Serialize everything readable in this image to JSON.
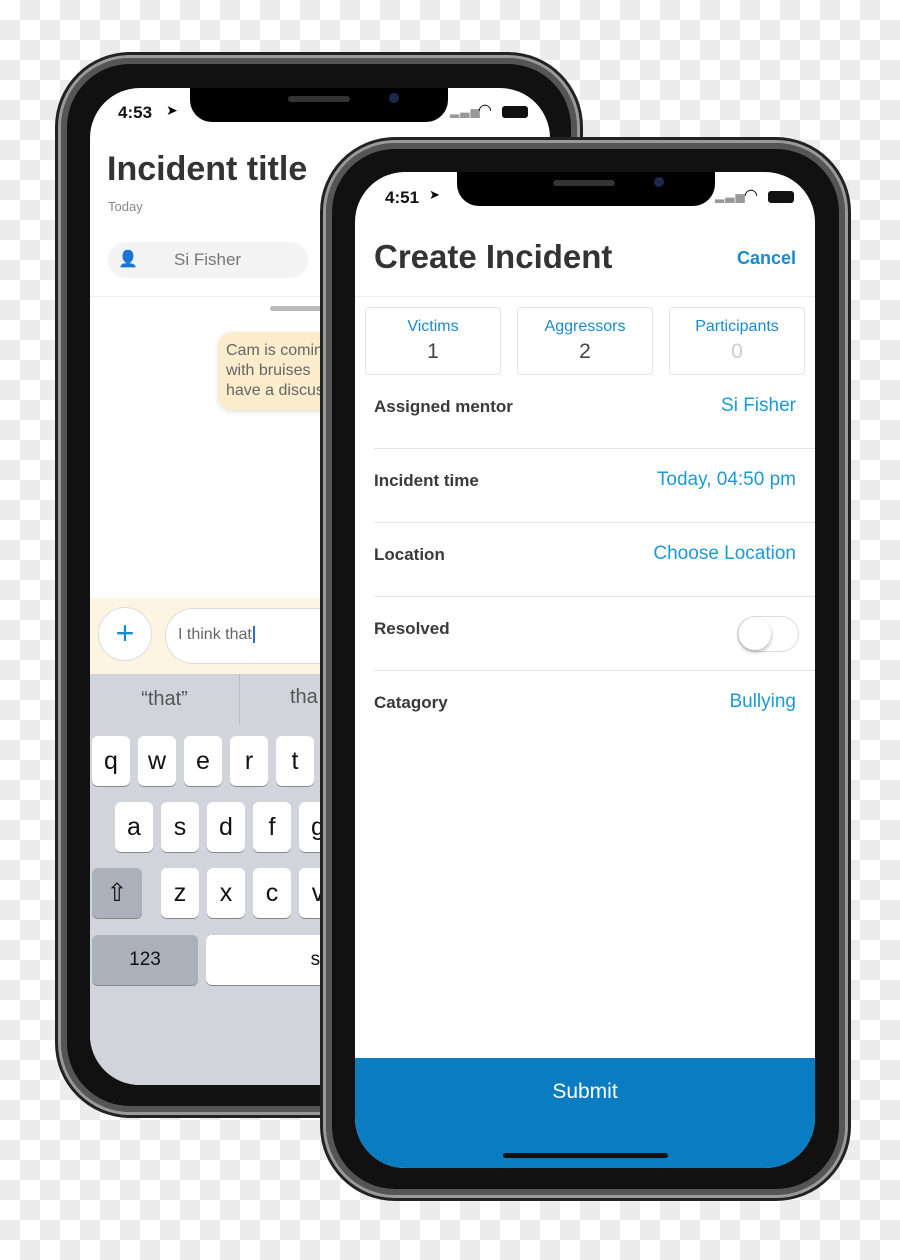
{
  "back_phone": {
    "status_time": "4:53",
    "title": "Incident title",
    "date": "Today",
    "assignee": "Si Fisher",
    "message_lines": [
      "Cam is comin",
      "with bruises",
      "have a discus"
    ],
    "composer_text": "I think that",
    "suggestions": [
      "“that”",
      "tha"
    ],
    "keys_row1": [
      "q",
      "w",
      "e",
      "r",
      "t"
    ],
    "keys_row2": [
      "a",
      "s",
      "d",
      "f",
      "g"
    ],
    "keys_row3": [
      "z",
      "x",
      "c",
      "v"
    ],
    "numbers_key": "123",
    "space_key": "spa"
  },
  "front_phone": {
    "status_time": "4:51",
    "title": "Create Incident",
    "cancel": "Cancel",
    "counts": [
      {
        "label": "Victims",
        "value": "1"
      },
      {
        "label": "Aggressors",
        "value": "2"
      },
      {
        "label": "Participants",
        "value": "0"
      }
    ],
    "rows": [
      {
        "label": "Assigned mentor",
        "value": "Si Fisher"
      },
      {
        "label": "Incident time",
        "value": "Today, 04:50 pm"
      },
      {
        "label": "Location",
        "value": "Choose Location"
      },
      {
        "label": "Resolved",
        "toggle": false
      },
      {
        "label": "Catagory",
        "value": "Bullying"
      }
    ],
    "submit": "Submit"
  },
  "colors": {
    "accent": "#1a9ad6",
    "submit": "#0a7cc2",
    "bubble": "#fbeccb"
  }
}
